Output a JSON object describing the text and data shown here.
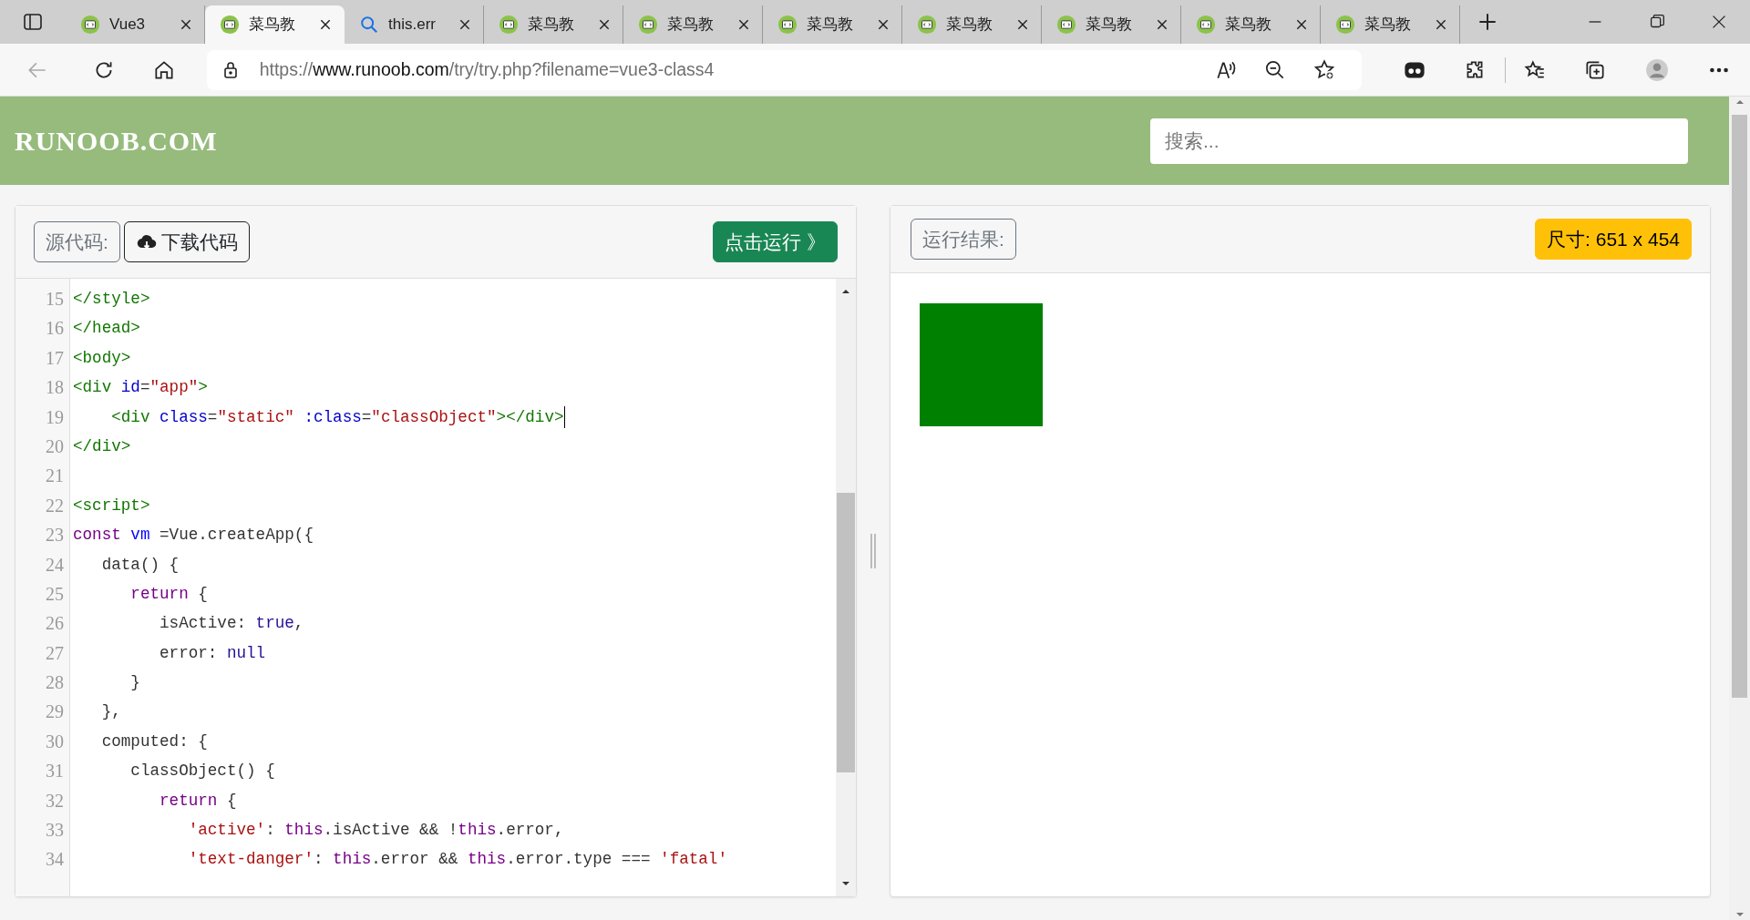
{
  "browser": {
    "tabs": [
      {
        "kind": "site",
        "title": "Vue3",
        "selected": false
      },
      {
        "kind": "site",
        "title": "菜鸟教",
        "selected": true
      },
      {
        "kind": "search",
        "title": "this.err",
        "selected": false
      },
      {
        "kind": "site",
        "title": "菜鸟教",
        "selected": false
      },
      {
        "kind": "site",
        "title": "菜鸟教",
        "selected": false
      },
      {
        "kind": "site",
        "title": "菜鸟教",
        "selected": false
      },
      {
        "kind": "site",
        "title": "菜鸟教",
        "selected": false
      },
      {
        "kind": "site",
        "title": "菜鸟教",
        "selected": false
      },
      {
        "kind": "site",
        "title": "菜鸟教",
        "selected": false
      },
      {
        "kind": "site",
        "title": "菜鸟教",
        "selected": false
      }
    ],
    "url": {
      "host_prefix": "https://",
      "host": "www.runoob.com",
      "path": "/try/try.php?filename=vue3-class4"
    }
  },
  "site": {
    "logo": "RUNOOB.COM",
    "search": {
      "placeholder": "搜索..."
    }
  },
  "editor": {
    "source_label": "源代码:",
    "download_button": "下载代码",
    "run_button": "点击运行 》",
    "lines": [
      {
        "number": "15",
        "cursor": false,
        "tokens": [
          {
            "kind": "tag",
            "text": "</style>"
          }
        ]
      },
      {
        "number": "16",
        "cursor": false,
        "tokens": [
          {
            "kind": "tag",
            "text": "</head>"
          }
        ]
      },
      {
        "number": "17",
        "cursor": false,
        "tokens": [
          {
            "kind": "tag",
            "text": "<body>"
          }
        ]
      },
      {
        "number": "18",
        "cursor": false,
        "tokens": [
          {
            "kind": "tag",
            "text": "<div "
          },
          {
            "kind": "attr",
            "text": "id"
          },
          {
            "kind": "plain",
            "text": "="
          },
          {
            "kind": "string",
            "text": "\"app\""
          },
          {
            "kind": "tag",
            "text": ">"
          }
        ]
      },
      {
        "number": "19",
        "cursor": true,
        "tokens": [
          {
            "kind": "tag",
            "text": "    <div "
          },
          {
            "kind": "attr",
            "text": "class"
          },
          {
            "kind": "plain",
            "text": "="
          },
          {
            "kind": "string",
            "text": "\"static\""
          },
          {
            "kind": "attr",
            "text": " :class"
          },
          {
            "kind": "plain",
            "text": "="
          },
          {
            "kind": "string",
            "text": "\"classObject\""
          },
          {
            "kind": "tag",
            "text": "></div>"
          }
        ]
      },
      {
        "number": "20",
        "cursor": false,
        "tokens": [
          {
            "kind": "tag",
            "text": "</div>"
          }
        ]
      },
      {
        "number": "21",
        "cursor": false
      },
      {
        "number": "22",
        "cursor": false,
        "tokens": [
          {
            "kind": "tag",
            "text": "<script>"
          }
        ]
      },
      {
        "number": "23",
        "cursor": false,
        "tokens": [
          {
            "kind": "keyword",
            "text": "const "
          },
          {
            "kind": "def",
            "text": "vm"
          },
          {
            "kind": "plain",
            "text": " =Vue.createApp({"
          }
        ]
      },
      {
        "number": "24",
        "cursor": false,
        "tokens": [
          {
            "kind": "plain",
            "text": "   data() {"
          }
        ]
      },
      {
        "number": "25",
        "cursor": false,
        "tokens": [
          {
            "kind": "keyword",
            "text": "      return"
          },
          {
            "kind": "plain",
            "text": " {"
          }
        ]
      },
      {
        "number": "26",
        "cursor": false,
        "tokens": [
          {
            "kind": "plain",
            "text": "         isActive: "
          },
          {
            "kind": "atom",
            "text": "true"
          },
          {
            "kind": "plain",
            "text": ","
          }
        ]
      },
      {
        "number": "27",
        "cursor": false,
        "tokens": [
          {
            "kind": "plain",
            "text": "         error: "
          },
          {
            "kind": "atom",
            "text": "null"
          }
        ]
      },
      {
        "number": "28",
        "cursor": false,
        "tokens": [
          {
            "kind": "plain",
            "text": "      }"
          }
        ]
      },
      {
        "number": "29",
        "cursor": false,
        "tokens": [
          {
            "kind": "plain",
            "text": "   },"
          }
        ]
      },
      {
        "number": "30",
        "cursor": false,
        "tokens": [
          {
            "kind": "plain",
            "text": "   computed: {"
          }
        ]
      },
      {
        "number": "31",
        "cursor": false,
        "tokens": [
          {
            "kind": "plain",
            "text": "      classObject() {"
          }
        ]
      },
      {
        "number": "32",
        "cursor": false,
        "tokens": [
          {
            "kind": "keyword",
            "text": "         return"
          },
          {
            "kind": "plain",
            "text": " {"
          }
        ]
      },
      {
        "number": "33",
        "cursor": false,
        "tokens": [
          {
            "kind": "string",
            "text": "            'active'"
          },
          {
            "kind": "plain",
            "text": ": "
          },
          {
            "kind": "keyword",
            "text": "this"
          },
          {
            "kind": "plain",
            "text": ".isActive && !"
          },
          {
            "kind": "keyword",
            "text": "this"
          },
          {
            "kind": "plain",
            "text": ".error,"
          }
        ]
      },
      {
        "number": "34",
        "cursor": false,
        "tokens": [
          {
            "kind": "string",
            "text": "            'text-danger'"
          },
          {
            "kind": "plain",
            "text": ": "
          },
          {
            "kind": "keyword",
            "text": "this"
          },
          {
            "kind": "plain",
            "text": ".error && "
          },
          {
            "kind": "keyword",
            "text": "this"
          },
          {
            "kind": "plain",
            "text": ".error.type === "
          },
          {
            "kind": "string",
            "text": "'fatal'"
          }
        ]
      }
    ]
  },
  "result": {
    "label": "运行结果:",
    "size_badge": "尺寸: 651 x 454"
  }
}
